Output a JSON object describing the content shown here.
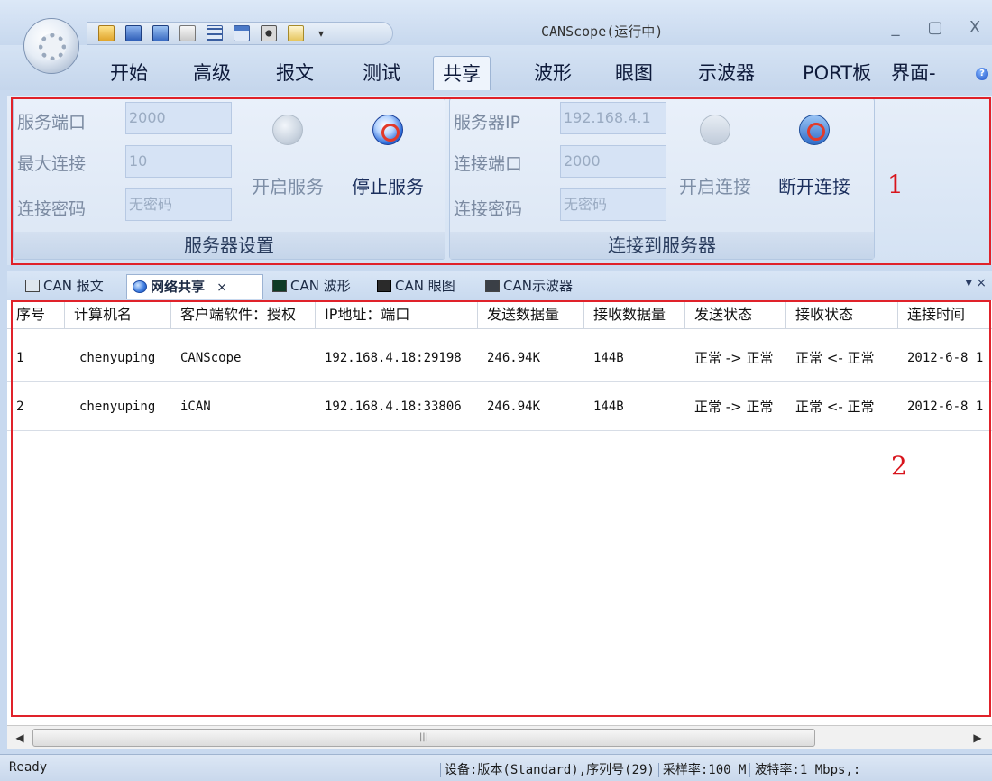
{
  "window": {
    "title": "CANScope(运行中)",
    "controls": [
      "_",
      "▢",
      "X"
    ]
  },
  "ribbon_tabs": [
    "开始",
    "高级",
    "报文",
    "测试",
    "共享",
    "波形",
    "眼图",
    "示波器",
    "PORT板",
    "界面-"
  ],
  "active_ribbon_tab": "共享",
  "server_settings": {
    "caption": "服务器设置",
    "port_label": "服务端口",
    "port_value": "2000",
    "max_conn_label": "最大连接",
    "max_conn_value": "10",
    "password_label": "连接密码",
    "password_value": "无密码",
    "start_label": "开启服务",
    "stop_label": "停止服务"
  },
  "connect_to_server": {
    "caption": "连接到服务器",
    "ip_label": "服务器IP",
    "ip_value": "192.168.4.1",
    "port_label": "连接端口",
    "port_value": "2000",
    "password_label": "连接密码",
    "password_value": "无密码",
    "connect_label": "开启连接",
    "disconnect_label": "断开连接"
  },
  "annotations": {
    "ribbon_marker": "1",
    "table_marker": "2"
  },
  "doc_tabs": [
    {
      "label": "CAN 报文"
    },
    {
      "label": "网络共享"
    },
    {
      "label": "CAN 波形"
    },
    {
      "label": "CAN 眼图"
    },
    {
      "label": "CAN示波器"
    }
  ],
  "doc_tab_close": "×",
  "doc_panel_controls": "▾ ×",
  "table": {
    "columns": [
      "序号",
      "计算机名",
      "客户端软件：授权",
      "IP地址：端口",
      "发送数据量",
      "接收数据量",
      "发送状态",
      "接收状态",
      "连接时间"
    ],
    "rows": [
      [
        "1",
        "chenyuping",
        "CANScope",
        "192.168.4.18:29198",
        "246.94K",
        "144B",
        "正常 -> 正常",
        "正常 <- 正常",
        "2012-6-8 1"
      ],
      [
        "2",
        "chenyuping",
        "iCAN",
        "192.168.4.18:33806",
        "246.94K",
        "144B",
        "正常 -> 正常",
        "正常 <- 正常",
        "2012-6-8 1"
      ]
    ]
  },
  "scrollbar": {
    "left_arrow": "◀",
    "right_arrow": "▶",
    "thumb_grip": "|||"
  },
  "status": {
    "ready": "Ready",
    "device": "设备:版本(Standard),序列号(29)",
    "sample_rate": "采样率:100 M",
    "baud_rate": "波特率:1 Mbps,:"
  },
  "colors": {
    "annotation_red": "#e0222a",
    "ribbon_bg": "#dbe6f4"
  }
}
